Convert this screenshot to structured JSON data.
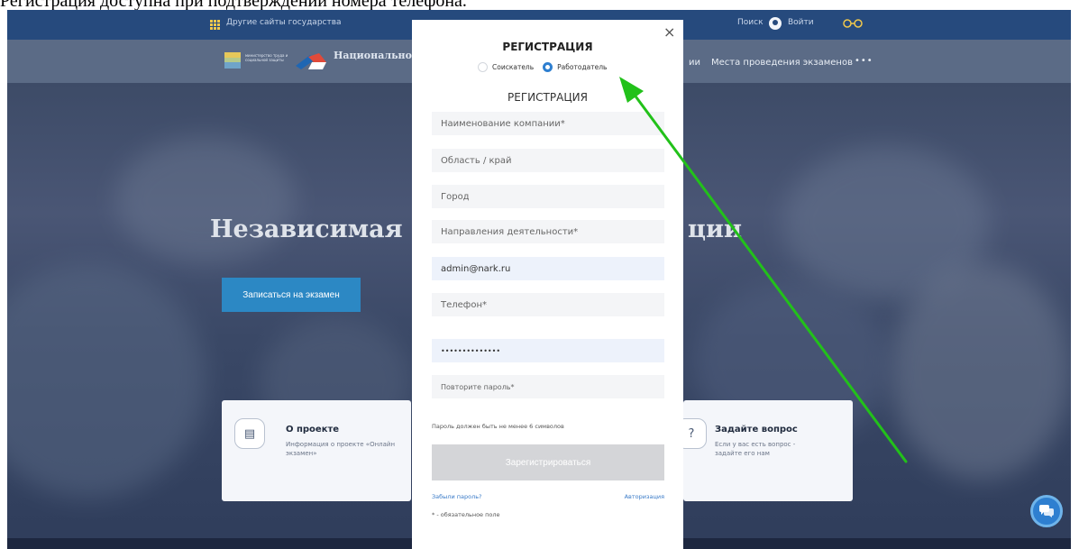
{
  "caption": "Регистрация доступна при подтверждении номера телефона.",
  "topbar": {
    "other_sites": "Другие сайты государства",
    "search": "Поиск",
    "login": "Войти"
  },
  "navbar": {
    "ministry_text": "министерство труда и социальной защиты",
    "agency_name": "Национальное агентство развития квалификаций",
    "nav_partial": "ии",
    "nav_places": "Места проведения экзаменов",
    "nav_more": "•••"
  },
  "hero": {
    "title_left": "Независимая",
    "title_right": "ции",
    "button": "Записаться на экзамен"
  },
  "cards": {
    "left": {
      "title": "О проекте",
      "text": "Информация о проекте «Онлайн экзамен»",
      "icon": "document-icon"
    },
    "right": {
      "title": "Задайте вопрос",
      "text": "Если у вас есть вопрос - задайте его нам",
      "icon": "question-icon"
    }
  },
  "modal": {
    "close": "×",
    "title_top": "РЕГИСТРАЦИЯ",
    "title_sub": "РЕГИСТРАЦИЯ",
    "radio_options": [
      {
        "label": "Соискатель",
        "checked": false
      },
      {
        "label": "Работодатель",
        "checked": true
      }
    ],
    "fields": {
      "company": {
        "placeholder": "Наименование компании*",
        "value": ""
      },
      "region": {
        "placeholder": "Область / край",
        "value": ""
      },
      "city": {
        "placeholder": "Город",
        "value": ""
      },
      "activity": {
        "placeholder": "Направления деятельности*",
        "value": ""
      },
      "email": {
        "placeholder": "",
        "value": "admin@nark.ru"
      },
      "phone": {
        "placeholder": "Телефон*",
        "value": ""
      },
      "password": {
        "placeholder": "",
        "value": "••••••••••••••"
      },
      "password_repeat": {
        "placeholder": "Повторите пароль*",
        "value": ""
      }
    },
    "hint": "Пароль должен быть не менее 6 символов",
    "submit": "Зарегистрироваться",
    "forgot": "Забыли пароль?",
    "auth": "Авторизация",
    "required_note": "* - обязательное поле"
  },
  "colors": {
    "topbar": "#264a7d",
    "accent": "#2e7fd0",
    "arrow": "#22c11a"
  }
}
